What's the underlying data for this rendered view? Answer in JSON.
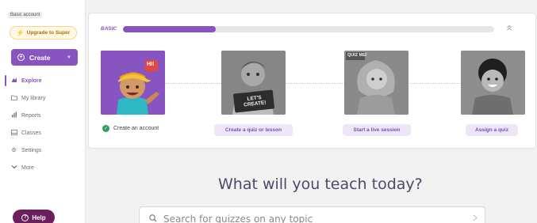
{
  "sidebar": {
    "account_label": "Basic account",
    "upgrade_label": "Upgrade to Super",
    "create_label": "Create",
    "nav": [
      {
        "label": "Explore",
        "icon": "compass-icon"
      },
      {
        "label": "My library",
        "icon": "folder-icon"
      },
      {
        "label": "Reports",
        "icon": "reports-icon"
      },
      {
        "label": "Classes",
        "icon": "classes-icon"
      },
      {
        "label": "Settings",
        "icon": "gear-icon"
      },
      {
        "label": "More",
        "icon": "chevron-down-icon"
      }
    ],
    "help_label": "Help"
  },
  "onboarding": {
    "plan_label": "BASIC",
    "progress": 0.25,
    "steps": [
      {
        "label": "Create an account",
        "done": true
      },
      {
        "label": "Create a quiz or lesson",
        "done": false
      },
      {
        "label": "Start a live session",
        "done": false
      },
      {
        "label": "Assign a quiz",
        "done": false
      }
    ],
    "badges": {
      "hi": "HI!",
      "lets_create": "LET'S CREATE!",
      "quiz_me": "QUIZ ME!"
    }
  },
  "main": {
    "heading": "What will you teach today?",
    "search_placeholder": "Search for quizzes on any topic"
  },
  "colors": {
    "accent": "#8854c0",
    "help": "#6b1f5c",
    "success": "#2e9e5a"
  }
}
